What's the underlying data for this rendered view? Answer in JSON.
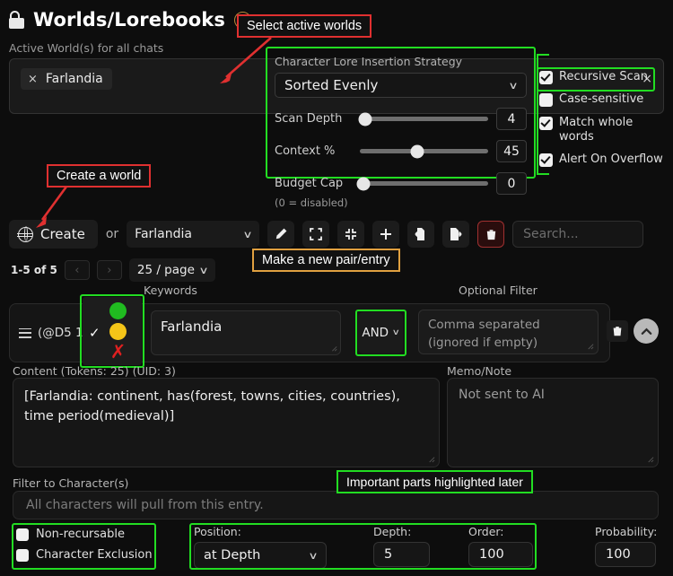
{
  "header": {
    "title": "Worlds/Lorebooks",
    "help_icon": "question-icon",
    "lock_icon": "unlocked-padlock-icon"
  },
  "active_worlds": {
    "label": "Active World(s) for all chats",
    "tags": [
      {
        "name": "Farlandia",
        "remove": "×"
      }
    ],
    "clear_all": "×"
  },
  "strategy": {
    "label": "Character Lore Insertion Strategy",
    "value": "Sorted Evenly",
    "chevron": "∨",
    "sliders": [
      {
        "label": "Scan Depth",
        "value": "4",
        "percent": 4
      },
      {
        "label": "Context %",
        "value": "45",
        "percent": 45
      }
    ]
  },
  "budget": {
    "label": "Budget Cap",
    "sub": "(0 = disabled)",
    "value": "0",
    "percent": 3
  },
  "checkboxes": [
    {
      "label": "Recursive Scan",
      "checked": true
    },
    {
      "label": "Case-sensitive",
      "checked": false
    },
    {
      "label": "Match whole words",
      "checked": true
    },
    {
      "label": "Alert On Overflow",
      "checked": true
    }
  ],
  "toolbar": {
    "create_label": "Create",
    "or_label": "or",
    "selected_world": "Farlandia",
    "chevron": "∨",
    "icons": [
      {
        "name": "pencil-icon",
        "title": "rename"
      },
      {
        "name": "expand-icon",
        "title": "open all"
      },
      {
        "name": "collapse-icon",
        "title": "close all"
      },
      {
        "name": "plus-icon",
        "title": "new entry"
      },
      {
        "name": "import-icon",
        "title": "import"
      },
      {
        "name": "export-icon",
        "title": "export"
      },
      {
        "name": "trash-icon",
        "title": "delete"
      }
    ],
    "search_placeholder": "Search..."
  },
  "pager": {
    "count": "1-5 of 5",
    "prev": "‹",
    "next": "›",
    "per_page": "25 / page",
    "chevron": "∨"
  },
  "columns": {
    "keywords": "Keywords",
    "optional_filter": "Optional Filter"
  },
  "entry": {
    "drag_handle": "drag-handle-icon",
    "tag": "(@D5 100",
    "keywords": "Farlandia",
    "logic": "AND",
    "logic_chevron": "∨",
    "optional_filter_placeholder": "Comma separated\n(ignored if empty)",
    "delete_icon": "trash-icon",
    "collapse_icon": "chevron-up-icon",
    "state_popup": {
      "check": "✓",
      "options": [
        {
          "name": "green-light",
          "color": "#20bb20"
        },
        {
          "name": "yellow-light",
          "color": "#f5c518"
        },
        {
          "name": "red-x",
          "color": "#e02020"
        }
      ]
    }
  },
  "content": {
    "label": "Content (Tokens: 25) (UID: 3)",
    "text": "[Farlandia: continent, has(forest, towns, cities, countries), time period(medieval)]"
  },
  "memo": {
    "label": "Memo/Note",
    "placeholder": "Not sent to AI"
  },
  "filter_characters": {
    "label": "Filter to Character(s)",
    "placeholder": "All characters will pull from this entry."
  },
  "bottom_options": {
    "checkboxes": [
      {
        "label": "Non-recursable",
        "checked": false
      },
      {
        "label": "Character Exclusion",
        "checked": false
      }
    ],
    "position": {
      "label": "Position:",
      "value": "at Depth",
      "chevron": "∨"
    },
    "depth": {
      "label": "Depth:",
      "value": "5"
    },
    "order": {
      "label": "Order:",
      "value": "100"
    },
    "probability": {
      "label": "Probability:",
      "value": "100"
    }
  },
  "annotations": [
    {
      "name": "select-active-worlds",
      "text": "Select active worlds",
      "color": "#e03030"
    },
    {
      "name": "create-a-world",
      "text": "Create a world",
      "color": "#e03030"
    },
    {
      "name": "make-a-new-pair-entry",
      "text": "Make a new pair/entry",
      "color": "#e0a040"
    },
    {
      "name": "important-parts-highlighted-later",
      "text": "Important parts highlighted later",
      "color": "#22dd22"
    }
  ],
  "colors": {
    "highlight": "#22dd22",
    "callout_red": "#e03030",
    "callout_orange": "#e0a040",
    "background": "#0d0d0d"
  }
}
